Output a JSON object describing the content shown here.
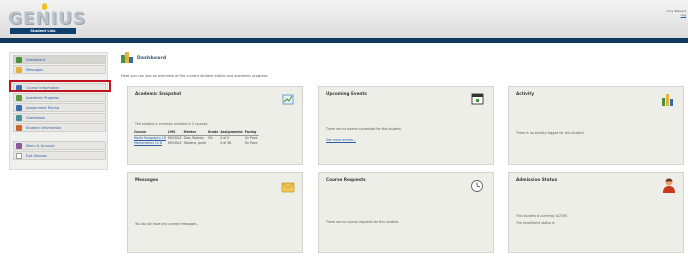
{
  "app": {
    "logo": "GENIUS",
    "logo_subtitle": "Student Link",
    "user_line1": "Cory Stewart",
    "user_logout": "Log"
  },
  "sidebar": {
    "items": [
      {
        "label": "Dashboard",
        "icon": "dashboard-icon",
        "color": "#4a8f3a"
      },
      {
        "label": "Messages",
        "icon": "envelope-icon",
        "color": "#e2b23a"
      },
      {
        "label": "Course Information",
        "icon": "book-icon",
        "color": "#3a6db0"
      },
      {
        "label": "Academic Progress",
        "icon": "chart-icon",
        "color": "#5a9a3a"
      },
      {
        "label": "Assignment Pacing",
        "icon": "clock-icon",
        "color": "#3a6db0"
      },
      {
        "label": "Gradebook",
        "icon": "grade-icon",
        "color": "#4a8f9a"
      },
      {
        "label": "Student Information",
        "icon": "person-icon",
        "color": "#c86a2a"
      },
      {
        "label": "Menu & Account",
        "icon": "account-icon",
        "color": "#8a5a9a"
      },
      {
        "label": "Exit Session",
        "icon": "exit-icon",
        "color": "#7a7a7a"
      }
    ]
  },
  "main": {
    "title": "Dashboard",
    "intro": "Here you can see an overview of the current student status and academic progress.",
    "panels": {
      "academic": {
        "title": "Academic Snapshot",
        "text": "The student is currently enrolled in 2 courses.",
        "headers": [
          "Course",
          "LMS",
          "Mentor",
          "Grade",
          "Assignments",
          "Pacing"
        ],
        "rows": [
          [
            "World Geography 1B",
            "MOODLE",
            "Diaz, Rodney",
            "0%",
            "0 of 5",
            "On Pace"
          ],
          [
            "Mathematics 10 B",
            "MOODLE",
            "Stevens, Janet",
            "",
            "0 of 36",
            "On Pace"
          ]
        ]
      },
      "events": {
        "title": "Upcoming Events",
        "text": "There are no events scheduled for this student.",
        "link": "See more events..."
      },
      "activity": {
        "title": "Activity",
        "text": "There is no activity logged for this student."
      },
      "messages": {
        "title": "Messages",
        "text": "You do not have any unread messages."
      },
      "requests": {
        "title": "Course Requests",
        "text": "There are no course requests for this student."
      },
      "admission": {
        "title": "Admission Status",
        "line1": "This student is currently ACTIVE.",
        "line2": "The enrollment status is"
      }
    }
  },
  "colors": {
    "header_bar": "#123a5e",
    "link": "#2a5ea8",
    "highlight": "#c1121f",
    "panel_bg": "#eeeee9"
  }
}
